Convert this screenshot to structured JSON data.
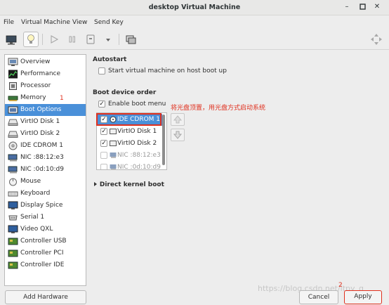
{
  "window": {
    "title": "desktop Virtual Machine"
  },
  "menubar": [
    "File",
    "Virtual Machine",
    "View",
    "Send Key"
  ],
  "toolbar": {
    "icons": [
      "monitor-icon",
      "lightbulb-icon",
      "play-icon",
      "pause-icon",
      "power-icon",
      "dropdown-arrow-icon",
      "clone-icon",
      "fullscreen-icon"
    ],
    "selected": "lightbulb-icon"
  },
  "sidebar": {
    "items": [
      {
        "label": "Overview",
        "icon": "overview-icon"
      },
      {
        "label": "Performance",
        "icon": "performance-icon"
      },
      {
        "label": "Processor",
        "icon": "processor-icon"
      },
      {
        "label": "Memory",
        "icon": "memory-icon"
      },
      {
        "label": "Boot Options",
        "icon": "boot-options-icon",
        "selected": true
      },
      {
        "label": "VirtIO Disk 1",
        "icon": "disk-icon"
      },
      {
        "label": "VirtIO Disk 2",
        "icon": "disk-icon"
      },
      {
        "label": "IDE CDROM 1",
        "icon": "cdrom-icon"
      },
      {
        "label": "NIC :88:12:e3",
        "icon": "nic-icon"
      },
      {
        "label": "NIC :0d:10:d9",
        "icon": "nic-icon"
      },
      {
        "label": "Mouse",
        "icon": "mouse-icon"
      },
      {
        "label": "Keyboard",
        "icon": "keyboard-icon"
      },
      {
        "label": "Display Spice",
        "icon": "display-icon"
      },
      {
        "label": "Serial 1",
        "icon": "serial-icon"
      },
      {
        "label": "Video QXL",
        "icon": "video-icon"
      },
      {
        "label": "Controller USB",
        "icon": "controller-icon"
      },
      {
        "label": "Controller PCI",
        "icon": "controller-icon"
      },
      {
        "label": "Controller IDE",
        "icon": "controller-icon"
      }
    ],
    "annotation": "1",
    "add_hardware": "Add Hardware"
  },
  "autostart": {
    "heading": "Autostart",
    "option": "Start virtual machine on host boot up",
    "checked": false
  },
  "boot": {
    "heading": "Boot device order",
    "enable_menu_label": "Enable boot menu",
    "enable_menu_checked": true,
    "annotation": "将光盘顶置，用光盘方式启动系统",
    "devices": [
      {
        "label": "IDE CDROM 1",
        "checked": true,
        "selected": true
      },
      {
        "label": "VirtIO Disk 1",
        "checked": true
      },
      {
        "label": "VirtIO Disk 2",
        "checked": true
      },
      {
        "label": "NIC :88:12:e3",
        "checked": false
      },
      {
        "label": "NIC :0d:10:d9",
        "checked": false
      }
    ]
  },
  "kernel": {
    "label": "Direct kernel boot"
  },
  "footer": {
    "cancel": "Cancel",
    "apply": "Apply",
    "annotation": "2"
  },
  "watermark": "https://blog.csdn.net/itpy_g"
}
